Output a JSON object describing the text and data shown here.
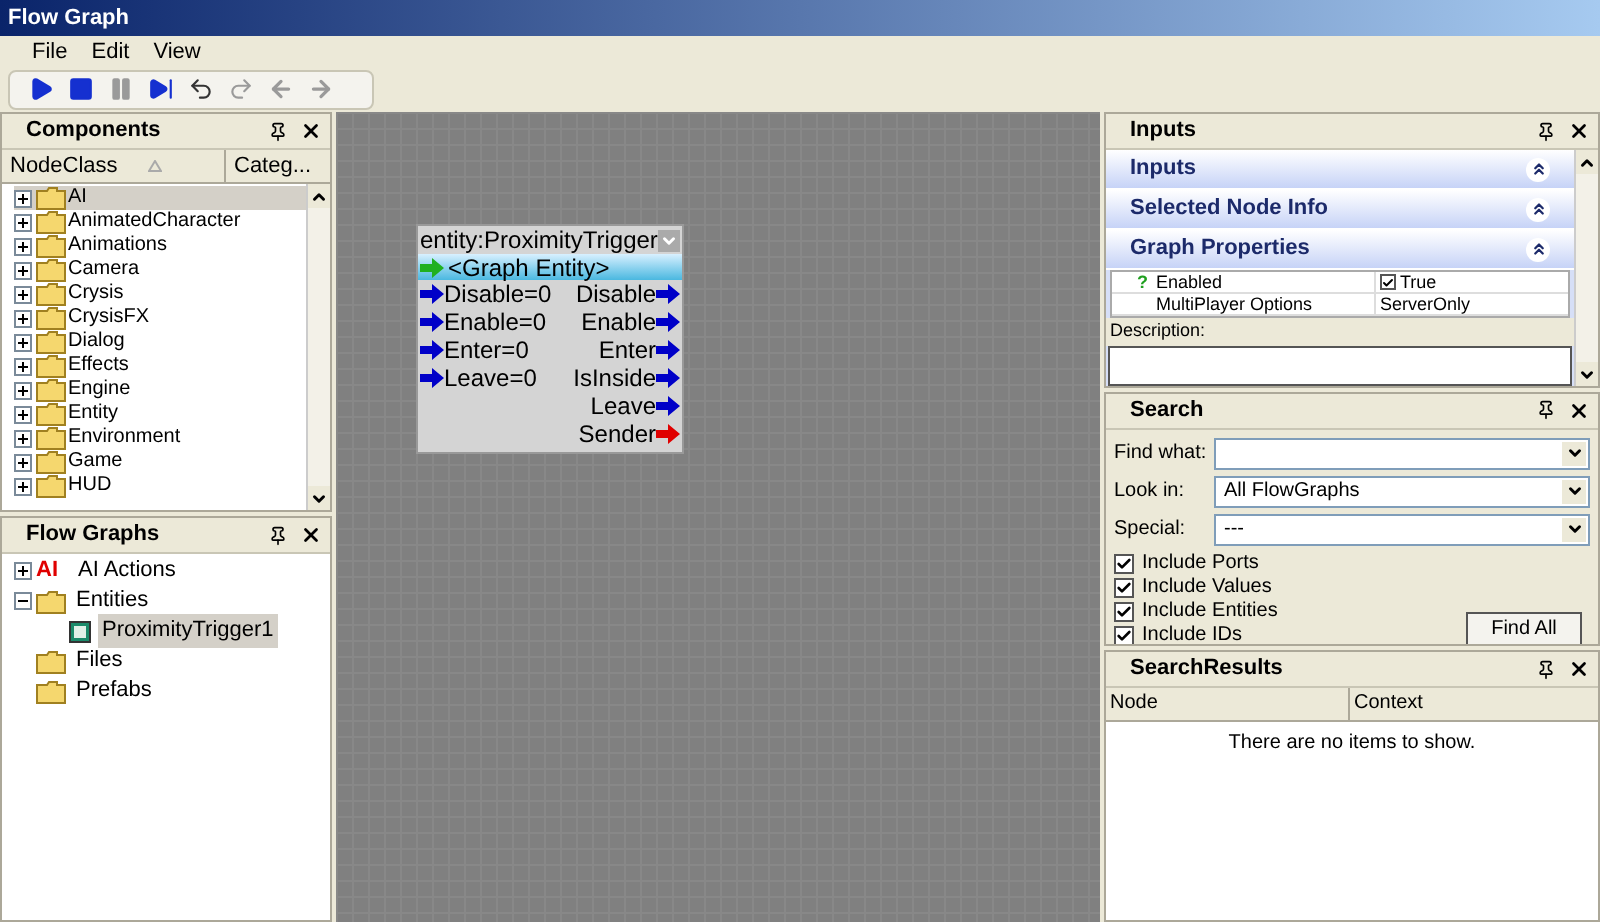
{
  "window": {
    "title": "Flow Graph"
  },
  "menu": [
    "File",
    "Edit",
    "View"
  ],
  "toolbar": {
    "buttons": [
      {
        "kind": "play"
      },
      {
        "kind": "stop"
      },
      {
        "kind": "pause",
        "disabled": true
      },
      {
        "kind": "step"
      },
      {
        "kind": "undo"
      },
      {
        "kind": "redo",
        "disabled": true
      },
      {
        "kind": "back",
        "disabled": true
      },
      {
        "kind": "forward",
        "disabled": true
      }
    ]
  },
  "components": {
    "title": "Components",
    "columns": [
      "NodeClass",
      "Categ..."
    ],
    "items": [
      {
        "label": "AI",
        "selected": true
      },
      {
        "label": "AnimatedCharacter",
        "selected": false
      },
      {
        "label": "Animations",
        "selected": false
      },
      {
        "label": "Camera",
        "selected": false
      },
      {
        "label": "Crysis",
        "selected": false
      },
      {
        "label": "CrysisFX",
        "selected": false
      },
      {
        "label": "Dialog",
        "selected": false
      },
      {
        "label": "Effects",
        "selected": false
      },
      {
        "label": "Engine",
        "selected": false
      },
      {
        "label": "Entity",
        "selected": false
      },
      {
        "label": "Environment",
        "selected": false
      },
      {
        "label": "Game",
        "selected": false
      },
      {
        "label": "HUD",
        "selected": false
      }
    ]
  },
  "flow_graphs": {
    "title": "Flow Graphs",
    "items": [
      {
        "label": "AI Actions",
        "kind": "ai",
        "icon_text": "AI",
        "expanded": false,
        "selected": false
      },
      {
        "label": "Entities",
        "kind": "folder",
        "expanded": true,
        "selected": false,
        "children": [
          {
            "label": "ProximityTrigger1",
            "kind": "graph",
            "selected": true
          }
        ]
      },
      {
        "label": "Files",
        "kind": "folder",
        "selected": false
      },
      {
        "label": "Prefabs",
        "kind": "folder",
        "selected": false
      }
    ]
  },
  "node": {
    "title": "entity:ProximityTrigger",
    "entity": "<Graph Entity>",
    "inputs": [
      "Disable=0",
      "Enable=0",
      "Enter=0",
      "Leave=0"
    ],
    "outputs": [
      {
        "label": "Disable",
        "color": "#0000c8"
      },
      {
        "label": "Enable",
        "color": "#0000c8"
      },
      {
        "label": "Enter",
        "color": "#0000c8"
      },
      {
        "label": "IsInside",
        "color": "#0000c8"
      },
      {
        "label": "Leave",
        "color": "#0000c8"
      },
      {
        "label": "Sender",
        "color": "#e00000"
      }
    ]
  },
  "inputs_panel": {
    "title": "Inputs",
    "sections": [
      "Inputs",
      "Selected Node Info",
      "Graph Properties"
    ],
    "properties": [
      {
        "name": "Enabled",
        "help": "?",
        "kind": "checkbox",
        "checked": true,
        "value": "True"
      },
      {
        "name": "MultiPlayer Options",
        "kind": "text",
        "value": "ServerOnly"
      }
    ],
    "description_label": "Description:"
  },
  "search": {
    "title": "Search",
    "fields": [
      {
        "label": "Find what:"
      },
      {
        "label": "Look in:",
        "value": "All FlowGraphs"
      },
      {
        "label": "Special:",
        "value": "---"
      }
    ],
    "options": [
      {
        "label": "Include Ports",
        "checked": true
      },
      {
        "label": "Include Values",
        "checked": true
      },
      {
        "label": "Include Entities",
        "checked": true
      },
      {
        "label": "Include IDs",
        "checked": true
      }
    ],
    "button": "Find All"
  },
  "search_results": {
    "title": "SearchResults",
    "columns": [
      "Node",
      "Context"
    ],
    "empty_text": "There are no items to show."
  }
}
